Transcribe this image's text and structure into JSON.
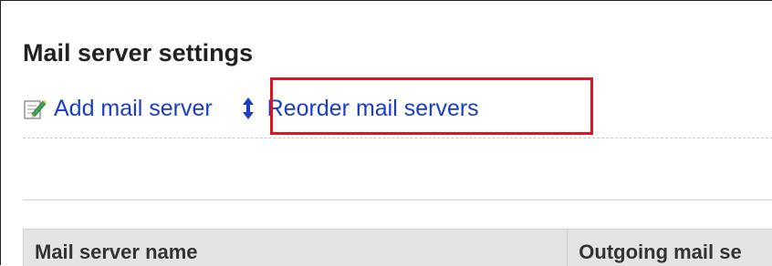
{
  "page": {
    "title": "Mail server settings"
  },
  "menu": {
    "add_label": "Add mail server",
    "add_icon": "edit-add-icon",
    "reorder_label": "Reorder mail servers",
    "reorder_icon": "reorder-arrows-icon"
  },
  "table": {
    "columns": [
      "Mail server name",
      "Outgoing mail se"
    ]
  },
  "colors": {
    "link": "#1a3cc8",
    "highlight": "#e0141e",
    "header_bg": "#e4e4e4"
  }
}
